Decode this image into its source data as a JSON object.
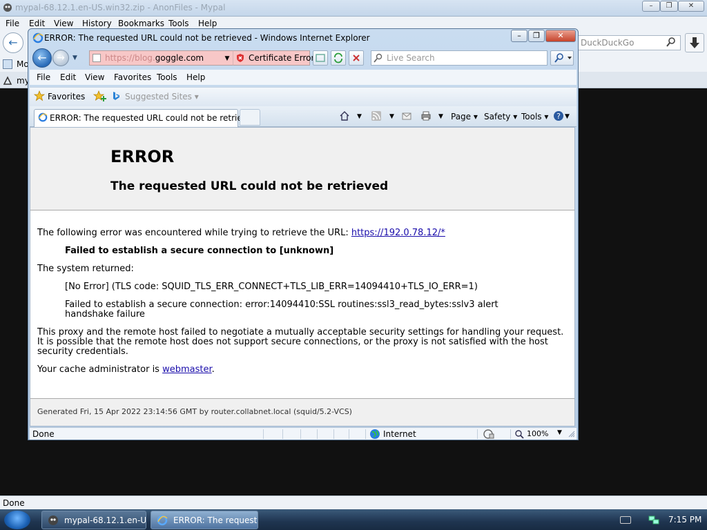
{
  "background_app": {
    "title": "mypal-68.12.1.en-US.win32.zip - AnonFiles - Mypal",
    "menu": [
      "File",
      "Edit",
      "View",
      "History",
      "Bookmarks",
      "Tools",
      "Help"
    ],
    "search_placeholder": "DuckDuckGo",
    "bookmark_label": "Mo",
    "tab_label": "my",
    "status": "Done",
    "window_buttons": [
      "–",
      "❐",
      "✕"
    ]
  },
  "ie": {
    "title": "ERROR: The requested URL could not be retrieved - Windows Internet Explorer",
    "address": {
      "protocol": "https://",
      "host_faded": "blog.",
      "host": "goggle.com"
    },
    "cert_error": "Certificate Error",
    "search_placeholder": "Live Search",
    "menu": [
      "File",
      "Edit",
      "View",
      "Favorites",
      "Tools",
      "Help"
    ],
    "favorites_label": "Favorites",
    "suggested_sites": "Suggested Sites ▾",
    "tab_label": "ERROR: The requested URL could not be retrieved",
    "commands": {
      "page": "Page ▾",
      "safety": "Safety ▾",
      "tools": "Tools ▾"
    },
    "status": {
      "left": "Done",
      "zone": "Internet",
      "zoom": "100%"
    }
  },
  "page": {
    "h1": "ERROR",
    "h2": "The requested URL could not be retrieved",
    "intro": "The following error was encountered while trying to retrieve the URL: ",
    "intro_link": "https://192.0.78.12/*",
    "failed": "Failed to establish a secure connection to [unknown]",
    "system_returned": "The system returned:",
    "tls_code": "[No Error] (TLS code: SQUID_TLS_ERR_CONNECT+TLS_LIB_ERR=14094410+TLS_IO_ERR=1)",
    "ssl_error": "Failed to establish a secure connection: error:14094410:SSL routines:ssl3_read_bytes:sslv3 alert handshake failure",
    "explanation": "This proxy and the remote host failed to negotiate a mutually acceptable security settings for handling your request. It is possible that the remote host does not support secure connections, or the proxy is not satisfied with the host security credentials.",
    "admin_prefix": "Your cache administrator is ",
    "admin_link": "webmaster",
    "admin_suffix": ".",
    "footer": "Generated Fri, 15 Apr 2022 23:14:56 GMT by router.collabnet.local (squid/5.2-VCS)"
  },
  "taskbar": {
    "tasks": [
      "mypal-68.12.1.en-U...",
      "ERROR: The request..."
    ],
    "clock": "7:15 PM"
  }
}
